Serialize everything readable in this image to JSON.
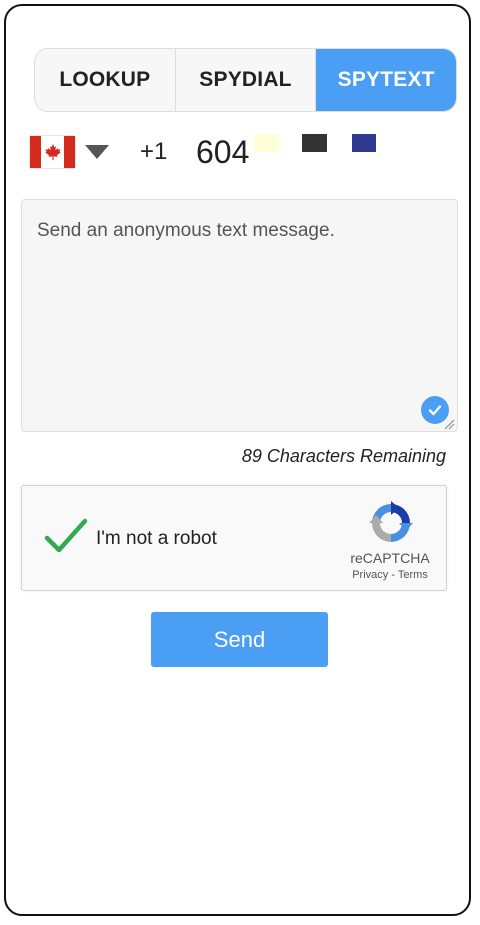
{
  "tabs": [
    {
      "label": "LOOKUP",
      "active": false
    },
    {
      "label": "SPYDIAL",
      "active": false
    },
    {
      "label": "SPYTEXT",
      "active": true
    }
  ],
  "phone": {
    "country_flag": "canada-flag",
    "dial_code": "+1",
    "number_value": "604"
  },
  "swatches": [
    "#fffed8",
    "#333333",
    "#2f3a8f"
  ],
  "message": {
    "placeholder": "Send an anonymous text message.",
    "value": "",
    "chars_remaining_label": "89 Characters Remaining"
  },
  "recaptcha": {
    "label": "I'm not a robot",
    "brand": "reCAPTCHA",
    "privacy": "Privacy",
    "separator": " - ",
    "terms": "Terms",
    "checked": true
  },
  "send_label": "Send",
  "colors": {
    "accent": "#4a9ff5",
    "check_green": "#34a853"
  }
}
